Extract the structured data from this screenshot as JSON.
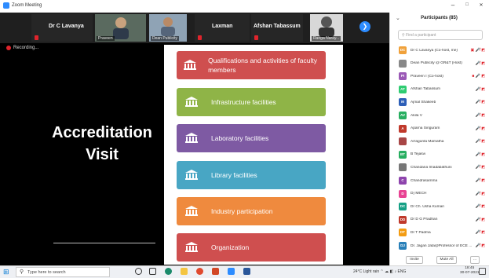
{
  "window": {
    "title": "Zoom Meeting",
    "min": "–",
    "max": "□",
    "close": "✕"
  },
  "video_strip": {
    "tiles": [
      {
        "name": "Dr C Lavanya",
        "caption": ""
      },
      {
        "name": "",
        "caption": "Praveen"
      },
      {
        "name": "",
        "caption": "Dean Publicity"
      },
      {
        "name": "Laxman",
        "caption": ""
      },
      {
        "name": "Afshan Tabassum",
        "caption": ""
      },
      {
        "name": "",
        "caption": "Ranga Naray..."
      }
    ],
    "next_arrow": "❯"
  },
  "recording_label": "Recording...",
  "slide": {
    "title_line1": "Accreditation",
    "title_line2": "Visit",
    "items": [
      {
        "label": "Qualifications and activities of faculty members",
        "color": "#cf4f4f"
      },
      {
        "label": "Infrastructure facilities",
        "color": "#8fb447"
      },
      {
        "label": "Laboratory facilities",
        "color": "#7e5aa3"
      },
      {
        "label": "Library facilities",
        "color": "#48a6c4"
      },
      {
        "label": "Industry participation",
        "color": "#ef8a3e"
      },
      {
        "label": "Organization",
        "color": "#cf4f4f"
      }
    ]
  },
  "participants": {
    "title": "Participants (85)",
    "collapse_icon": "⌄",
    "search_placeholder": "Find a participant",
    "list": [
      {
        "initials": "DC",
        "name": "Dr C Lavanya (Co-host, me)",
        "color": "#f0a13a",
        "icons": "▣ 🎤̸ ◩"
      },
      {
        "initials": "",
        "name": "Dean Publicity @ GR&T (Host)",
        "color": "#888888",
        "icons": "🎤̸ ◩"
      },
      {
        "initials": "PI",
        "name": "Praveen I (Co-host)",
        "color": "#9b59b6",
        "icons": "■ 🎤 ◩"
      },
      {
        "initials": "AT",
        "name": "Afshan Tabassum",
        "color": "#2ecc71",
        "icons": "🎤̸ ◩"
      },
      {
        "initials": "M",
        "name": "Ajmal Shakeeb",
        "color": "#2d5fb8",
        "icons": "🎤̸ ◩"
      },
      {
        "initials": "AV",
        "name": "Akila V",
        "color": "#27ae60",
        "icons": "🎤̸ ◩"
      },
      {
        "initials": "A",
        "name": "Aparna Siriguram",
        "color": "#c0392b",
        "icons": "🎤̸ ◩"
      },
      {
        "initials": "",
        "name": "Arragunta Mamatha",
        "color": "#a84646",
        "icons": "🎤̸ ◩"
      },
      {
        "initials": "BT",
        "name": "B Tejasvi",
        "color": "#27ae60",
        "icons": "🎤̸ ◩"
      },
      {
        "initials": "",
        "name": "Chandana Imadabathuni",
        "color": "#777777",
        "icons": "🎤̸ ◩"
      },
      {
        "initials": "C",
        "name": "Chandrasamma",
        "color": "#8e44ad",
        "icons": "🎤̸ ◩"
      },
      {
        "initials": "D",
        "name": "D) MECH",
        "color": "#e84393",
        "icons": "🎤̸ ◩"
      },
      {
        "initials": "DC",
        "name": "Dr Ch. Usha Kumari",
        "color": "#16a085",
        "icons": "🎤̸ ◩"
      },
      {
        "initials": "DD",
        "name": "Dr D G Pradhan",
        "color": "#c0392b",
        "icons": "🎤̸ ◩"
      },
      {
        "initials": "DT",
        "name": "Dr T Padma",
        "color": "#f39c12",
        "icons": "🎤̸ ◩"
      },
      {
        "initials": "DJ",
        "name": "Dr. Jagan Jata@Professor of ECE ...",
        "color": "#2980b9",
        "icons": "🎤̸ ◩"
      }
    ],
    "invite_label": "Invite",
    "mute_all_label": "Mute All",
    "more_label": "..."
  },
  "taskbar": {
    "search_placeholder": "Type here to search",
    "weather": "24°C  Light rain",
    "lang": "ENG",
    "time": "18:45",
    "date": "30-07-2021"
  }
}
